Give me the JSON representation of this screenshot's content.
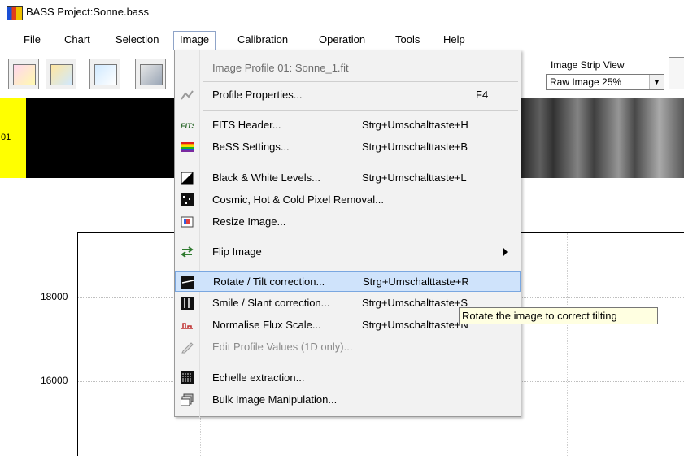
{
  "window": {
    "title": "BASS Project:Sonne.bass"
  },
  "menubar": {
    "items": [
      "File",
      "Chart",
      "Selection",
      "Image",
      "Calibration",
      "Operation",
      "Tools",
      "Help"
    ]
  },
  "toolbar": {
    "strip_view_label": "Image Strip View",
    "strip_view_value": "Raw Image 25%"
  },
  "strip": {
    "number": "01"
  },
  "chart": {
    "ticks": [
      "18000",
      "16000"
    ]
  },
  "image_menu": {
    "header": "Image Profile 01: Sonne_1.fit",
    "items": [
      {
        "label": "Profile Properties...",
        "shortcut": "F4",
        "icon": "profile-properties-icon"
      },
      {
        "label": "FITS Header...",
        "shortcut": "Strg+Umschalttaste+H",
        "icon": "fits-icon"
      },
      {
        "label": "BeSS Settings...",
        "shortcut": "Strg+Umschalttaste+B",
        "icon": "rainbow-icon"
      },
      {
        "label": "Black & White Levels...",
        "shortcut": "Strg+Umschalttaste+L",
        "icon": "contrast-icon"
      },
      {
        "label": "Cosmic, Hot & Cold Pixel Removal...",
        "shortcut": "",
        "icon": "pixel-noise-icon"
      },
      {
        "label": "Resize Image...",
        "shortcut": "",
        "icon": "resize-icon"
      },
      {
        "label": "Flip Image",
        "shortcut": "",
        "icon": "flip-icon"
      },
      {
        "label": "Rotate / Tilt correction...",
        "shortcut": "Strg+Umschalttaste+R",
        "icon": "rotate-icon"
      },
      {
        "label": "Smile / Slant correction...",
        "shortcut": "Strg+Umschalttaste+S",
        "icon": "smile-icon"
      },
      {
        "label": "Normalise Flux Scale...",
        "shortcut": "Strg+Umschalttaste+N",
        "icon": "normalise-icon"
      },
      {
        "label": "Edit Profile Values (1D only)...",
        "shortcut": "",
        "icon": "pencil-icon"
      },
      {
        "label": "Echelle extraction...",
        "shortcut": "",
        "icon": "echelle-icon"
      },
      {
        "label": "Bulk Image Manipulation...",
        "shortcut": "",
        "icon": "bulk-icon"
      }
    ]
  },
  "tooltip": "Rotate the image to correct tilting"
}
